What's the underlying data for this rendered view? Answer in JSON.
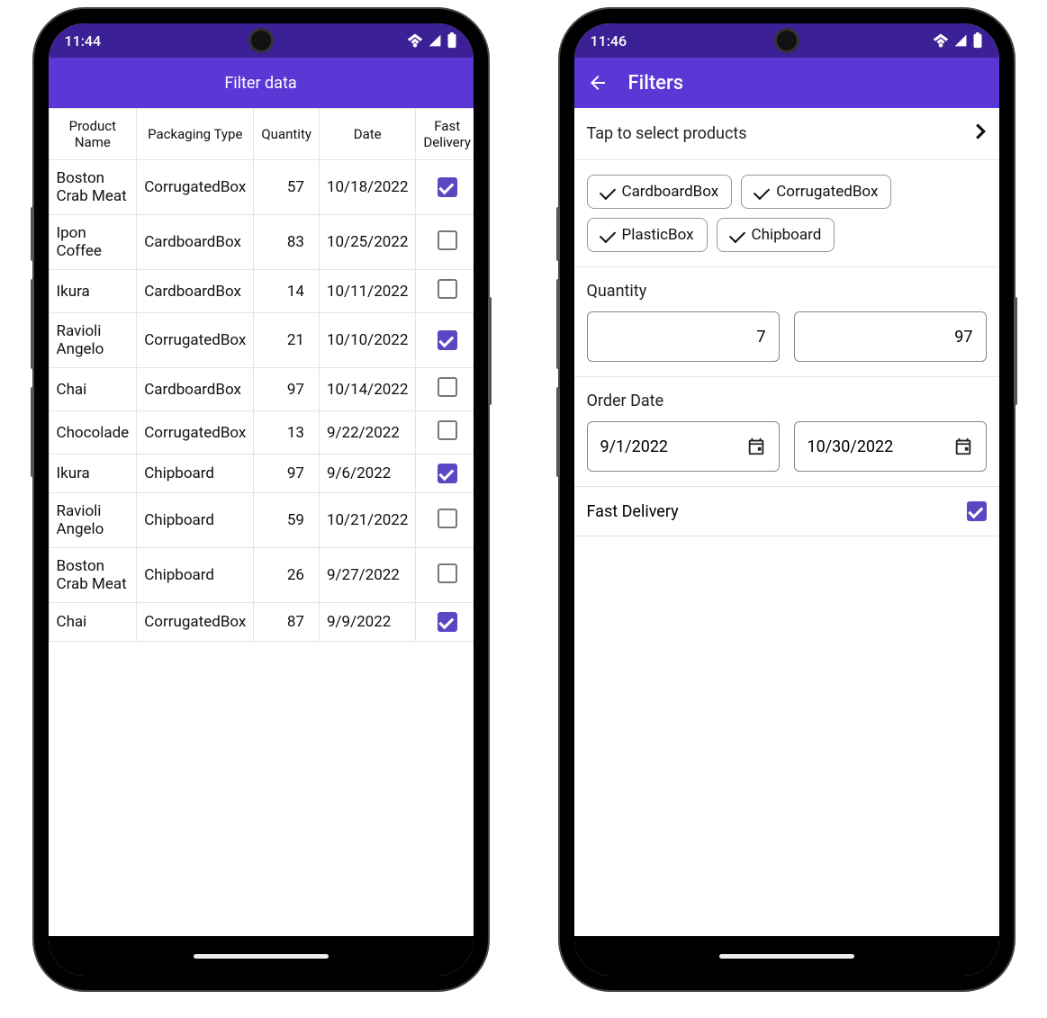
{
  "left": {
    "status_time": "11:44",
    "appbar_title": "Filter data",
    "columns": [
      "Product Name",
      "Packaging Type",
      "Quantity",
      "Date",
      "Fast Delivery"
    ],
    "rows": [
      {
        "product": "Boston Crab Meat",
        "pack": "CorrugatedBox",
        "qty": "57",
        "date": "10/18/2022",
        "fast": true
      },
      {
        "product": "Ipon Coffee",
        "pack": "CardboardBox",
        "qty": "83",
        "date": "10/25/2022",
        "fast": false
      },
      {
        "product": "Ikura",
        "pack": "CardboardBox",
        "qty": "14",
        "date": "10/11/2022",
        "fast": false
      },
      {
        "product": "Ravioli Angelo",
        "pack": "CorrugatedBox",
        "qty": "21",
        "date": "10/10/2022",
        "fast": true
      },
      {
        "product": "Chai",
        "pack": "CardboardBox",
        "qty": "97",
        "date": "10/14/2022",
        "fast": false
      },
      {
        "product": "Chocolade",
        "pack": "CorrugatedBox",
        "qty": "13",
        "date": "9/22/2022",
        "fast": false
      },
      {
        "product": "Ikura",
        "pack": "Chipboard",
        "qty": "97",
        "date": "9/6/2022",
        "fast": true
      },
      {
        "product": "Ravioli Angelo",
        "pack": "Chipboard",
        "qty": "59",
        "date": "10/21/2022",
        "fast": false
      },
      {
        "product": "Boston Crab Meat",
        "pack": "Chipboard",
        "qty": "26",
        "date": "9/27/2022",
        "fast": false
      },
      {
        "product": "Chai",
        "pack": "CorrugatedBox",
        "qty": "87",
        "date": "9/9/2022",
        "fast": true
      }
    ]
  },
  "right": {
    "status_time": "11:46",
    "appbar_title": "Filters",
    "select_products_label": "Tap to select products",
    "chips": [
      "CardboardBox",
      "CorrugatedBox",
      "PlasticBox",
      "Chipboard"
    ],
    "quantity_label": "Quantity",
    "quantity_min": "7",
    "quantity_max": "97",
    "order_date_label": "Order Date",
    "date_from": "9/1/2022",
    "date_to": "10/30/2022",
    "fast_delivery_label": "Fast Delivery",
    "fast_delivery_checked": true
  }
}
